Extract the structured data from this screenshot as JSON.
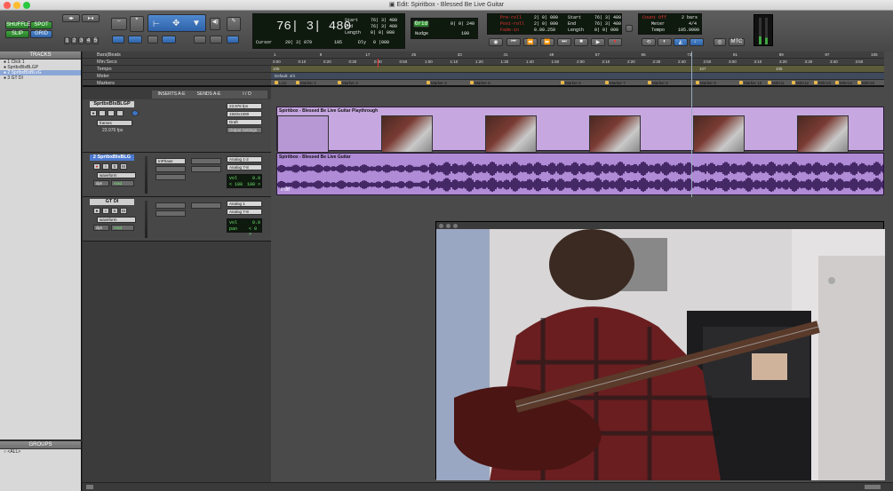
{
  "window": {
    "title": "Edit: Spiritbox - Blessed Be Live Guitar"
  },
  "modes": {
    "shuffle": "SHUFFLE",
    "spot": "SPOT",
    "slip": "SLIP",
    "grid": "GRID"
  },
  "zoom_presets": [
    "1",
    "2",
    "3",
    "4",
    "5"
  ],
  "counter": {
    "main": "76| 3| 480",
    "cursor_label": "Cursor",
    "cursor_value": "20| 3| 079",
    "zoom_value": "105",
    "dly_label": "Dly",
    "dly_value": "0 |000"
  },
  "selection": {
    "start_label": "Start",
    "end_label": "End",
    "length_label": "Length",
    "start": "76| 3| 480",
    "end": "76| 3| 480",
    "length": "0| 0| 000"
  },
  "grid_nudge": {
    "grid_label": "Grid",
    "grid_value": "0| 0| 240",
    "nudge_label": "Nudge",
    "nudge_value": "100"
  },
  "preroll": {
    "preroll_label": "Pre-roll",
    "postroll_label": "Post-roll",
    "fadein_label": "Fade-in",
    "preroll": "2| 0| 000",
    "postroll": "2| 0| 000",
    "fadein": "0.00.250"
  },
  "transport_sel": {
    "start": "76| 3| 480",
    "end": "76| 3| 480",
    "length": "0| 0| 000"
  },
  "countoff": {
    "label": "Count Off",
    "value": "2 bars",
    "meter_label": "Meter",
    "meter_value": "4/4",
    "tempo_label": "Tempo",
    "tempo_value": "105.0000"
  },
  "mtc_label": "MTC",
  "tracks_panel": {
    "header": "TRACKS",
    "items": [
      "1 Click 1",
      "SprtbxBlsBLGP",
      "2 SprtbxBlsBLvG",
      "3 GT DI"
    ]
  },
  "groups_panel": {
    "header": "GROUPS",
    "items": [
      "<ALL>"
    ]
  },
  "columns": {
    "inserts": "INSERTS A-E",
    "sends": "SENDS A-E",
    "io": "I / O"
  },
  "rulers": {
    "bars_beats": "Bars|Beats",
    "min_secs": "Min:Secs",
    "tempo": "Tempo",
    "meter": "Meter",
    "markers": "Markers"
  },
  "bar_ticks": [
    "1",
    "9",
    "17",
    "25",
    "33",
    "41",
    "49",
    "57",
    "65",
    "73",
    "81",
    "89",
    "97",
    "105"
  ],
  "time_ticks": [
    "0:00",
    "0:10",
    "0:20",
    "0:30",
    "0:40",
    "0:50",
    "1:00",
    "1:10",
    "1:20",
    "1:30",
    "1:40",
    "1:50",
    "2:00",
    "2:10",
    "2:20",
    "2:30",
    "2:40",
    "2:50",
    "3:00",
    "3:10",
    "3:20",
    "3:30",
    "3:40",
    "3:50"
  ],
  "tempo_ruler": {
    "start": "105",
    "change1": "107",
    "change2": "105"
  },
  "meter_ruler": {
    "default": "Default: 4/4"
  },
  "markers": [
    "Lct1",
    "Marker 2",
    "Marker 3",
    "Marker 4",
    "Marker 5",
    "Marker 6",
    "Marker 7",
    "Marker 8",
    "Marker 9",
    "Marker 10",
    "Mrkr11",
    "Mrkr12",
    "Mrkr13",
    "Mrkr14",
    "Mrkr15"
  ],
  "tracks": [
    {
      "name": "SprtbxBlsBLGP",
      "fps": "23.976 fps",
      "res": "1920x1080",
      "quality": "Draft",
      "settings": "Output Settings",
      "view": "frames",
      "fps2": "23.976 fps",
      "clip": "Spiritbox - Blessed Be Live Guitar Playthrough"
    },
    {
      "name": "2 SprtbxBlsBLG",
      "insert": "InPhase",
      "io_in": "Analog 1-2",
      "io_out": "Analog 7-8",
      "view": "waveform",
      "dyn": "dyn",
      "mode": "read",
      "vol_label": "vol",
      "vol": "0.0",
      "pan_l": "< 100",
      "pan_r": "100 >",
      "clip": "Spiritbox - Blessed Be Live Guitar",
      "gain": "0 dB"
    },
    {
      "name": "GT DI",
      "io_in": "Analog 1",
      "io_out": "Analog 7-8",
      "view": "waveform",
      "dyn": "dyn",
      "mode": "read",
      "vol_label": "vol",
      "vol": "0.0",
      "pan_label": "pan",
      "pan": "< 0 >"
    }
  ],
  "colors": {
    "video_clip": "#c7a7e0",
    "audio_clip": "#b08bd6",
    "waveform": "#2a0f4a",
    "lcd_text": "#6fe36f",
    "blue_btn": "#3d74c4"
  }
}
